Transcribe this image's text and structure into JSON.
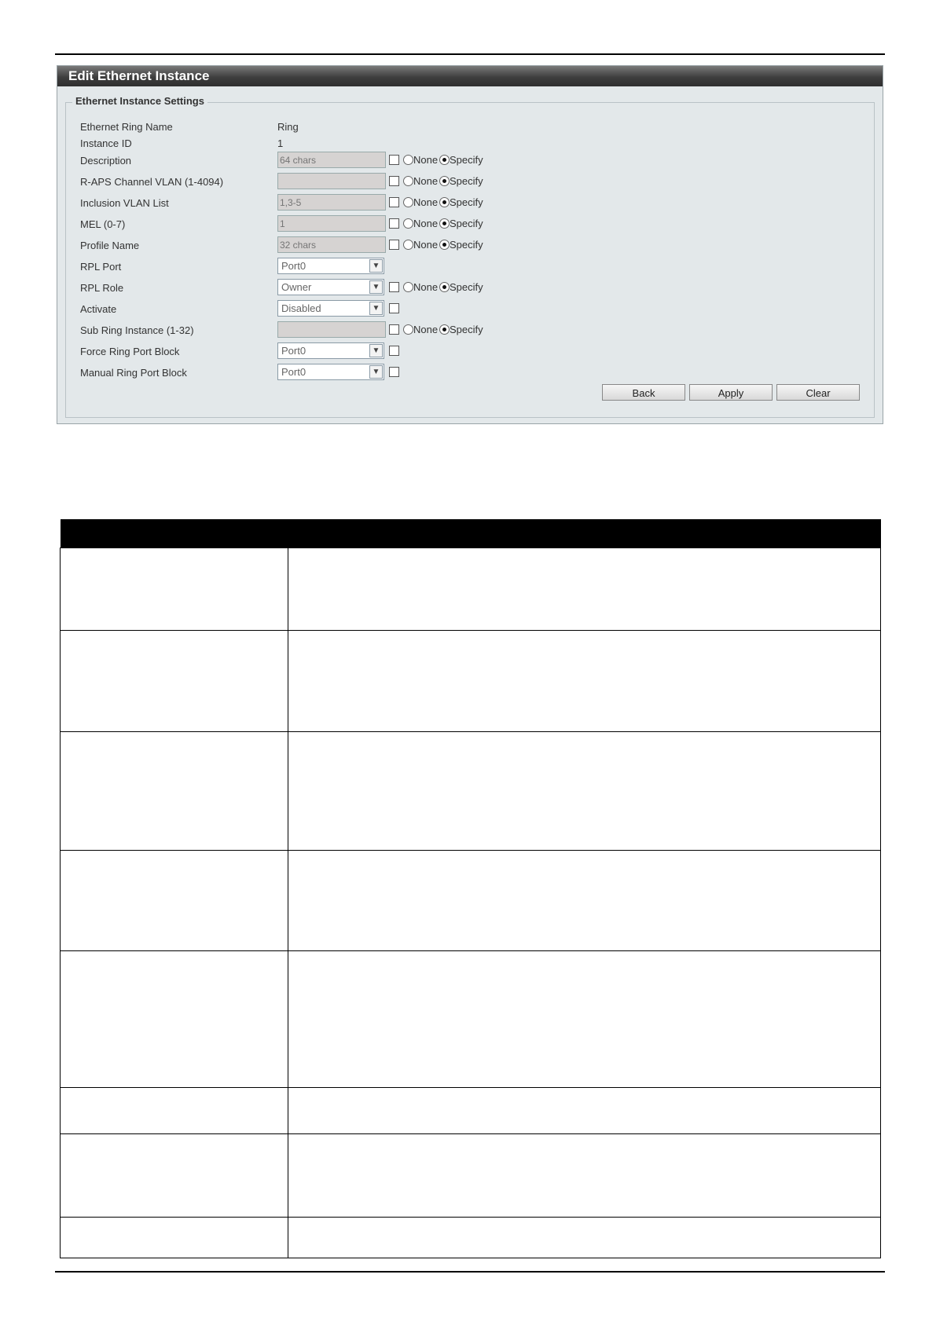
{
  "panel": {
    "title": "Edit Ethernet Instance",
    "legend": "Ethernet Instance Settings"
  },
  "fields": {
    "ring_name": {
      "label": "Ethernet Ring Name",
      "value": "Ring"
    },
    "instance_id": {
      "label": "Instance ID",
      "value": "1"
    },
    "description": {
      "label": "Description",
      "placeholder": "64 chars"
    },
    "raps_vlan": {
      "label": "R-APS Channel VLAN (1-4094)",
      "placeholder": ""
    },
    "inclusion_vlan": {
      "label": "Inclusion VLAN List",
      "placeholder": "1,3-5"
    },
    "mel": {
      "label": "MEL (0-7)",
      "placeholder": "1"
    },
    "profile_name": {
      "label": "Profile Name",
      "placeholder": "32 chars"
    },
    "rpl_port": {
      "label": "RPL Port",
      "selected": "Port0"
    },
    "rpl_role": {
      "label": "RPL Role",
      "selected": "Owner"
    },
    "activate": {
      "label": "Activate",
      "selected": "Disabled"
    },
    "sub_ring": {
      "label": "Sub Ring Instance (1-32)",
      "placeholder": ""
    },
    "force_block": {
      "label": "Force Ring Port Block",
      "selected": "Port0"
    },
    "manual_block": {
      "label": "Manual Ring Port Block",
      "selected": "Port0"
    }
  },
  "radio_labels": {
    "none": "None",
    "specify": "Specify"
  },
  "buttons": {
    "back": "Back",
    "apply": "Apply",
    "clear": "Clear"
  },
  "icons": {
    "dropdown": "chevron-down-icon"
  },
  "description_table": {
    "rows": 8
  }
}
